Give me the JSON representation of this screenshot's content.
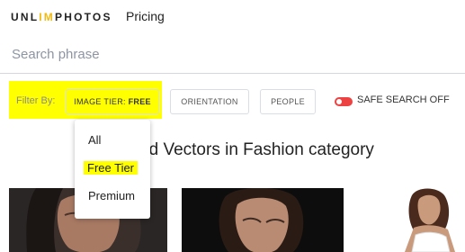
{
  "header": {
    "logo_prefix": "UNL",
    "logo_brand": "IM",
    "logo_suffix": "PHOTOS",
    "nav_pricing": "Pricing"
  },
  "search": {
    "placeholder": "Search phrase",
    "value": ""
  },
  "filters": {
    "label": "Filter By:",
    "image_tier_prefix": "IMAGE TIER: ",
    "image_tier_value": "FREE",
    "orientation": "ORIENTATION",
    "people": "PEOPLE",
    "safe_search": "SAFE SEARCH OFF",
    "safe_search_on": false
  },
  "tier_dropdown": {
    "options": [
      "All",
      "Free Tier",
      "Premium"
    ],
    "highlighted": "Free Tier"
  },
  "main": {
    "heading_visible": "ages and Vectors in Fashion category"
  },
  "colors": {
    "brand": "#f2b90f",
    "highlight": "#ffff00",
    "toggle_off": "#ec4242"
  },
  "icons": [
    "safe-search-toggle"
  ]
}
